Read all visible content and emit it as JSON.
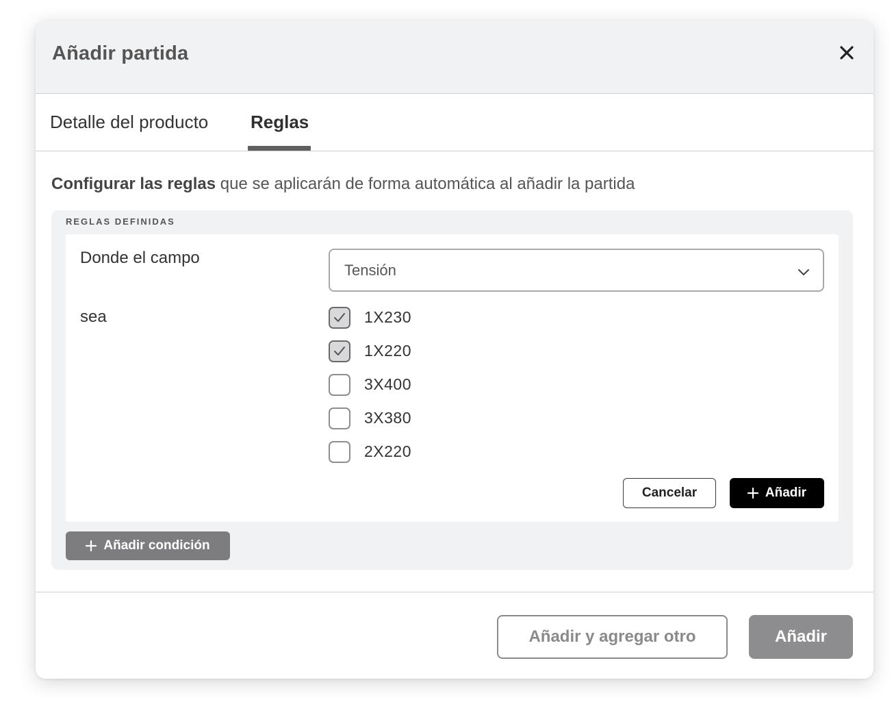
{
  "modal": {
    "title": "Añadir partida",
    "close_icon": "close-icon"
  },
  "tabs": [
    {
      "label": "Detalle del producto",
      "active": false
    },
    {
      "label": "Reglas",
      "active": true
    }
  ],
  "intro": {
    "bold": "Configurar las reglas",
    "rest": " que se aplicarán de forma automática al añadir la partida"
  },
  "rules": {
    "heading": "REGLAS DEFINIDAS",
    "field_label": "Donde el campo",
    "field_value": "Tensión",
    "condition_label": "sea",
    "options": [
      {
        "label": "1X230",
        "checked": true
      },
      {
        "label": "1X220",
        "checked": true
      },
      {
        "label": "3X400",
        "checked": false
      },
      {
        "label": "3X380",
        "checked": false
      },
      {
        "label": "2X220",
        "checked": false
      }
    ],
    "cancel_label": "Cancelar",
    "add_label": "Añadir",
    "add_condition_label": "Añadir condición"
  },
  "footer": {
    "add_another_label": "Añadir y agregar otro",
    "add_label": "Añadir"
  },
  "colors": {
    "primary_button": "#000000",
    "disabled_button": "#8d8d8f",
    "header_background": "#f1f2f4",
    "checkbox_checked_fill": "#d9d9db"
  }
}
